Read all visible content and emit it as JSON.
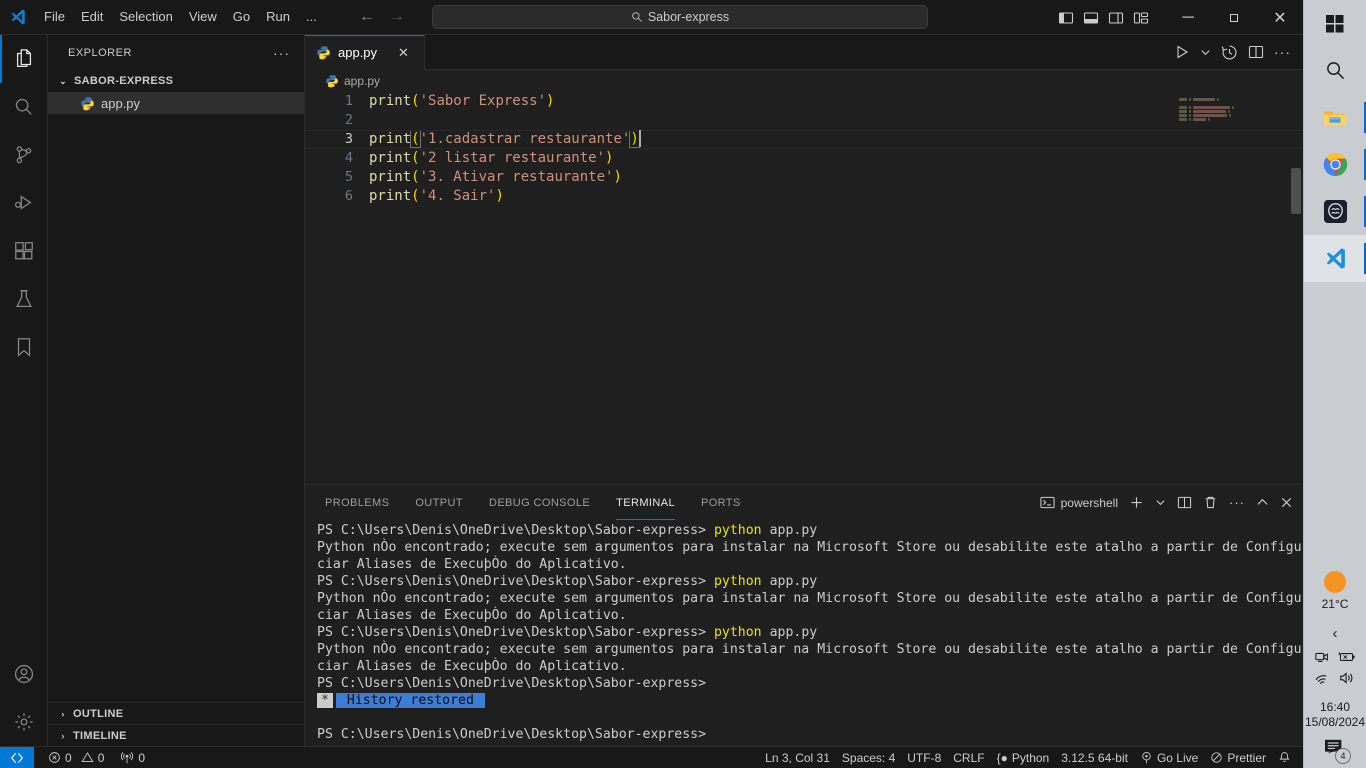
{
  "titlebar": {
    "menu": [
      "File",
      "Edit",
      "Selection",
      "View",
      "Go",
      "Run",
      "..."
    ],
    "search_value": "Sabor-express",
    "back_arrow": "←",
    "forward_arrow": "→",
    "minimize": "─",
    "maximize": "❐",
    "close": "✕"
  },
  "activitybar": {
    "items": [
      {
        "name": "explorer",
        "title": "Explorer"
      },
      {
        "name": "search",
        "title": "Search"
      },
      {
        "name": "source-control",
        "title": "Source Control"
      },
      {
        "name": "run-debug",
        "title": "Run and Debug"
      },
      {
        "name": "extensions",
        "title": "Extensions"
      },
      {
        "name": "testing",
        "title": "Testing"
      },
      {
        "name": "bookmarks",
        "title": "Bookmarks"
      },
      {
        "name": "accounts",
        "title": "Accounts"
      },
      {
        "name": "settings",
        "title": "Manage"
      }
    ]
  },
  "sidebar": {
    "title": "EXPLORER",
    "more_actions": "···",
    "root_folder": "SABOR-EXPRESS",
    "files": [
      {
        "label": "app.py",
        "selected": true
      }
    ],
    "sections": [
      "OUTLINE",
      "TIMELINE"
    ],
    "chevron_open": "⌄",
    "chevron_closed": "›"
  },
  "editor": {
    "tab_label": "app.py",
    "tab_close": "✕",
    "breadcrumb": "app.py",
    "actions": [
      "run-python-file",
      "run-dropdown",
      "timeline-history",
      "split-editor",
      "more-actions"
    ],
    "code": [
      {
        "num": "1",
        "tokens": [
          {
            "t": "print",
            "c": "fn"
          },
          {
            "t": "(",
            "c": "p1"
          },
          {
            "t": "'Sabor Express'",
            "c": "str"
          },
          {
            "t": ")",
            "c": "p1"
          }
        ]
      },
      {
        "num": "2",
        "tokens": []
      },
      {
        "num": "3",
        "active": true,
        "tokens": [
          {
            "t": "print",
            "c": "fn"
          },
          {
            "t": "(",
            "c": "p1 brk-hl"
          },
          {
            "t": "'1.cadastrar restaurante'",
            "c": "str"
          },
          {
            "t": ")",
            "c": "p1 brk-hl"
          }
        ]
      },
      {
        "num": "4",
        "tokens": [
          {
            "t": "print",
            "c": "fn"
          },
          {
            "t": "(",
            "c": "p1"
          },
          {
            "t": "'2 listar restaurante'",
            "c": "str"
          },
          {
            "t": ")",
            "c": "p1"
          }
        ]
      },
      {
        "num": "5",
        "tokens": [
          {
            "t": "print",
            "c": "fn"
          },
          {
            "t": "(",
            "c": "p1"
          },
          {
            "t": "'3. Ativar restaurante'",
            "c": "str"
          },
          {
            "t": ")",
            "c": "p1"
          }
        ]
      },
      {
        "num": "6",
        "tokens": [
          {
            "t": "print",
            "c": "fn"
          },
          {
            "t": "(",
            "c": "p1"
          },
          {
            "t": "'4. Sair'",
            "c": "str"
          },
          {
            "t": ")",
            "c": "p1"
          }
        ]
      }
    ]
  },
  "panel": {
    "tabs": [
      "PROBLEMS",
      "OUTPUT",
      "DEBUG CONSOLE",
      "TERMINAL",
      "PORTS"
    ],
    "active_tab": "TERMINAL",
    "shell_name": "powershell",
    "actions": [
      "new-terminal",
      "terminal-dropdown",
      "split-terminal",
      "kill-terminal",
      "more-actions",
      "maximize-panel",
      "close-panel"
    ],
    "terminal_lines": [
      {
        "type": "prompt",
        "path": "PS C:\\Users\\Denis\\OneDrive\\Desktop\\Sabor-express> ",
        "cmd": "python",
        "args": " app.py"
      },
      {
        "type": "out",
        "text": "Python nÒo encontrado; execute sem argumentos para instalar na Microsoft Store ou desabilite este atalho a partir de Configuraþ§es > Geren"
      },
      {
        "type": "out",
        "text": "ciar Aliases de ExecuþÒo do Aplicativo."
      },
      {
        "type": "prompt",
        "path": "PS C:\\Users\\Denis\\OneDrive\\Desktop\\Sabor-express> ",
        "cmd": "python",
        "args": " app.py"
      },
      {
        "type": "out",
        "text": "Python nÒo encontrado; execute sem argumentos para instalar na Microsoft Store ou desabilite este atalho a partir de Configuraþ§es > Geren"
      },
      {
        "type": "out",
        "text": "ciar Aliases de ExecuþÒo do Aplicativo."
      },
      {
        "type": "prompt",
        "path": "PS C:\\Users\\Denis\\OneDrive\\Desktop\\Sabor-express> ",
        "cmd": "python",
        "args": " app.py"
      },
      {
        "type": "out",
        "text": "Python nÒo encontrado; execute sem argumentos para instalar na Microsoft Store ou desabilite este atalho a partir de Configuraþ§es > Geren"
      },
      {
        "type": "out",
        "text": "ciar Aliases de ExecuþÒo do Aplicativo."
      },
      {
        "type": "prompt",
        "path": "PS C:\\Users\\Denis\\OneDrive\\Desktop\\Sabor-express>",
        "cmd": "",
        "args": ""
      },
      {
        "type": "history",
        "star": "*",
        "text": "History restored"
      },
      {
        "type": "blank",
        "text": ""
      },
      {
        "type": "prompt",
        "path": "PS C:\\Users\\Denis\\OneDrive\\Desktop\\Sabor-express>",
        "cmd": "",
        "args": ""
      }
    ]
  },
  "statusbar": {
    "remote_icon": "remote-window",
    "errors": "0",
    "warnings": "0",
    "ports": "0",
    "cursor_position": "Ln 3, Col 31",
    "indentation": "Spaces: 4",
    "encoding": "UTF-8",
    "eol": "CRLF",
    "language": "Python",
    "interpreter": "3.12.5 64-bit",
    "go_live": "Go Live",
    "prettier": "Prettier",
    "bell": "🔔"
  },
  "taskbar": {
    "items": [
      {
        "name": "start-button",
        "label": "Start"
      },
      {
        "name": "taskbar-search",
        "label": "Search"
      },
      {
        "name": "file-explorer",
        "label": "File Explorer"
      },
      {
        "name": "google-chrome",
        "label": "Google Chrome"
      },
      {
        "name": "app-icon-dark",
        "label": "App"
      },
      {
        "name": "vscode",
        "label": "Visual Studio Code"
      }
    ],
    "weather_temp": "21°C",
    "tray_chevron": "‹",
    "time": "16:40",
    "date": "15/08/2024",
    "notification_count": "4"
  },
  "colors": {
    "accent": "#0078d4",
    "bg": "#1f1f1f",
    "panel_bg": "#181818",
    "string": "#ce9178",
    "function": "#dcdcaa",
    "paren": "#ffd700",
    "highlight": "#3a7fd5"
  }
}
